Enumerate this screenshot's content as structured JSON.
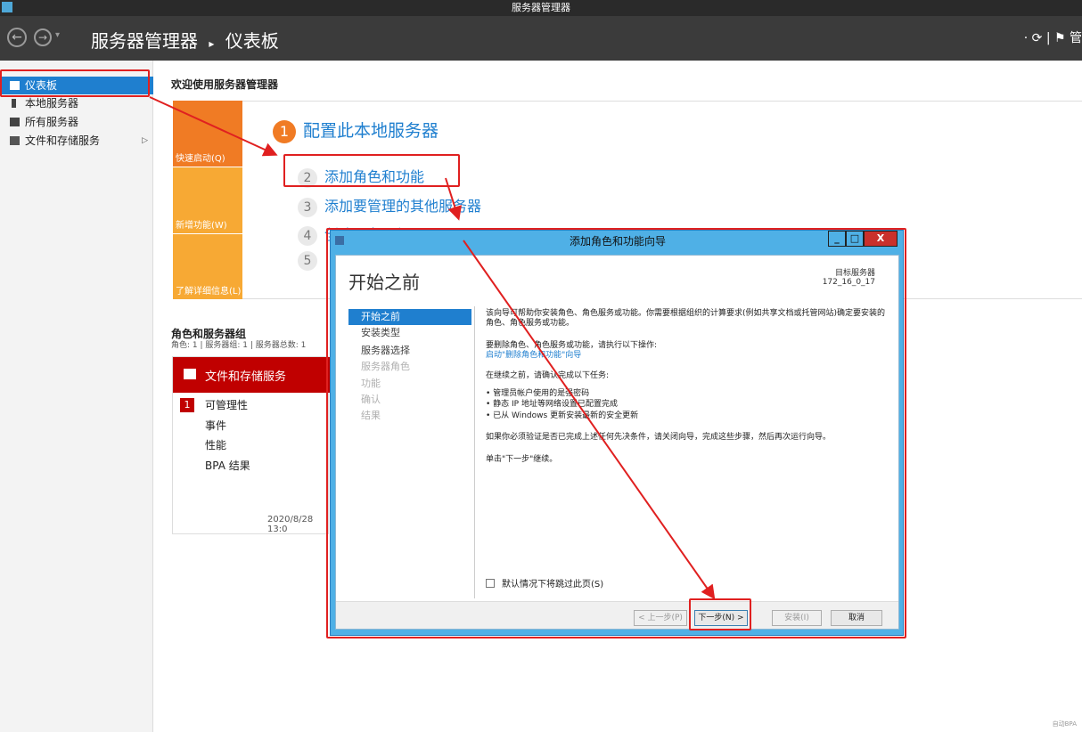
{
  "window": {
    "title": "服务器管理器"
  },
  "header": {
    "back_icon": "back-arrow-icon",
    "forward_icon": "forward-arrow-icon",
    "breadcrumb_root": "服务器管理器",
    "breadcrumb_sep": "▸",
    "breadcrumb_current": "仪表板",
    "right_text": "· ⟳ | ⚑  管"
  },
  "sidebar": {
    "items": [
      {
        "label": "仪表板",
        "icon": "dashboard-icon",
        "active": true
      },
      {
        "label": "本地服务器",
        "icon": "server-icon"
      },
      {
        "label": "所有服务器",
        "icon": "servers-icon"
      },
      {
        "label": "文件和存储服务",
        "icon": "storage-icon",
        "expand": "▷"
      }
    ]
  },
  "welcome": {
    "title": "欢迎使用服务器管理器",
    "tiles": [
      {
        "label": "快速启动(Q)",
        "color": "#f07b24"
      },
      {
        "label": "新增功能(W)",
        "color": "#f7a934"
      },
      {
        "label": "了解详细信息(L)",
        "color": "#f7a934"
      }
    ],
    "steps": [
      {
        "num": "1",
        "label": "配置此本地服务器"
      },
      {
        "num": "2",
        "label": "添加角色和功能"
      },
      {
        "num": "3",
        "label": "添加要管理的其他服务器"
      },
      {
        "num": "4",
        "label": "创建服务器组"
      },
      {
        "num": "5",
        "label": ""
      }
    ]
  },
  "roles": {
    "title": "角色和服务器组",
    "subtitle": "角色: 1 | 服务器组: 1 | 服务器总数: 1",
    "card": {
      "title": "文件和存储服务",
      "badge": "1",
      "rows": [
        "可管理性",
        "事件",
        "性能",
        "BPA 结果"
      ],
      "date": "2020/8/28 13:0"
    }
  },
  "dialog": {
    "title": "添加角色和功能向导",
    "min": "_",
    "max": "□",
    "close": "X",
    "heading": "开始之前",
    "target_label": "目标服务器",
    "target_value": "172_16_0_17",
    "nav": [
      {
        "label": "开始之前",
        "state": "active"
      },
      {
        "label": "安装类型",
        "state": "normal"
      },
      {
        "label": "服务器选择",
        "state": "normal"
      },
      {
        "label": "服务器角色",
        "state": "disabled"
      },
      {
        "label": "功能",
        "state": "disabled"
      },
      {
        "label": "确认",
        "state": "disabled"
      },
      {
        "label": "结果",
        "state": "disabled"
      }
    ],
    "content": {
      "p1": "该向导可帮助你安装角色、角色服务或功能。你需要根据组织的计算要求(例如共享文档或托管网站)确定要安装的角色、角色服务或功能。",
      "p2": "要删除角色、角色服务或功能，请执行以下操作:",
      "p2_link": "启动\"删除角色和功能\"向导",
      "p3": "在继续之前，请确认完成以下任务:",
      "bullets": [
        "• 管理员帐户使用的是强密码",
        "• 静态 IP 地址等网络设置已配置完成",
        "• 已从 Windows 更新安装最新的安全更新"
      ],
      "p4": "如果你必须验证是否已完成上述任何先决条件，请关闭向导，完成这些步骤，然后再次运行向导。",
      "p5": "单击\"下一步\"继续。"
    },
    "skip_label": "默认情况下将跳过此页(S)",
    "buttons": {
      "prev": "< 上一步(P)",
      "next": "下一步(N) >",
      "install": "安装(I)",
      "cancel": "取消"
    }
  },
  "watermark": "自动BPA",
  "colors": {
    "accent": "#1f7fcf",
    "annotation": "#e02020",
    "role_red": "#c00000"
  }
}
